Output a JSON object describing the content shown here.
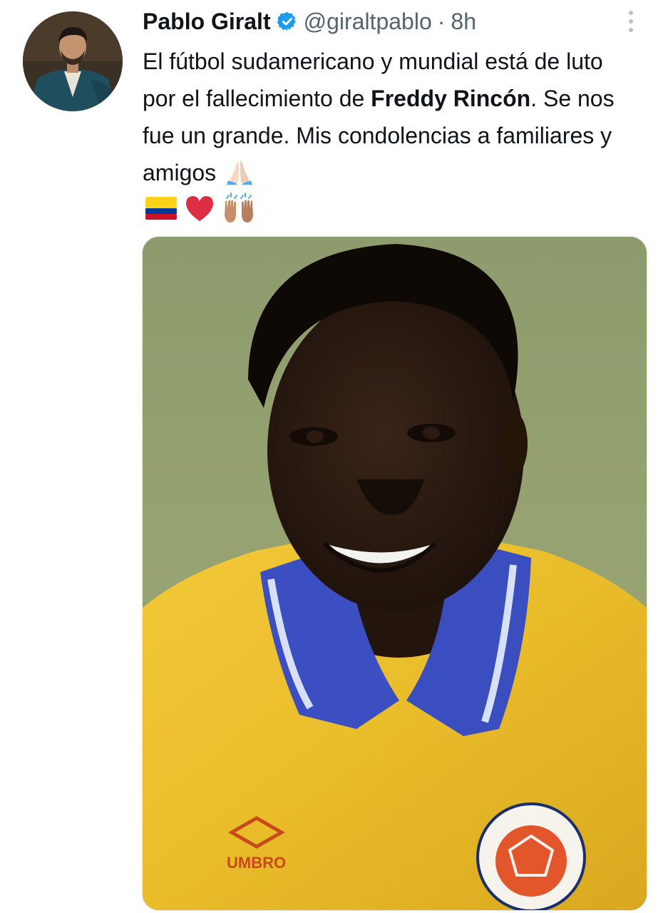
{
  "tweet": {
    "author": {
      "display_name": "Pablo Giralt",
      "handle": "@giraltpablo",
      "verified": true,
      "avatar_icon": "profile-photo"
    },
    "separator": "·",
    "timestamp": "8h",
    "text": {
      "part1": "El fútbol sudamericano y mundial está de luto por el fallecimiento de ",
      "bold_name": "Freddy Rincón",
      "part2": ". Se nos fue un grande. Mis condolencias a familiares y amigos"
    },
    "emojis": [
      "folded-hands",
      "colombia-flag",
      "red-heart",
      "raising-hands"
    ],
    "media": {
      "alt": "Photo of Freddy Rincón in the yellow Colombia jersey",
      "jersey_brand": "UMBRO"
    }
  },
  "colors": {
    "text_primary": "#0f1419",
    "text_secondary": "#536471",
    "verified_blue": "#1d9bf0"
  }
}
